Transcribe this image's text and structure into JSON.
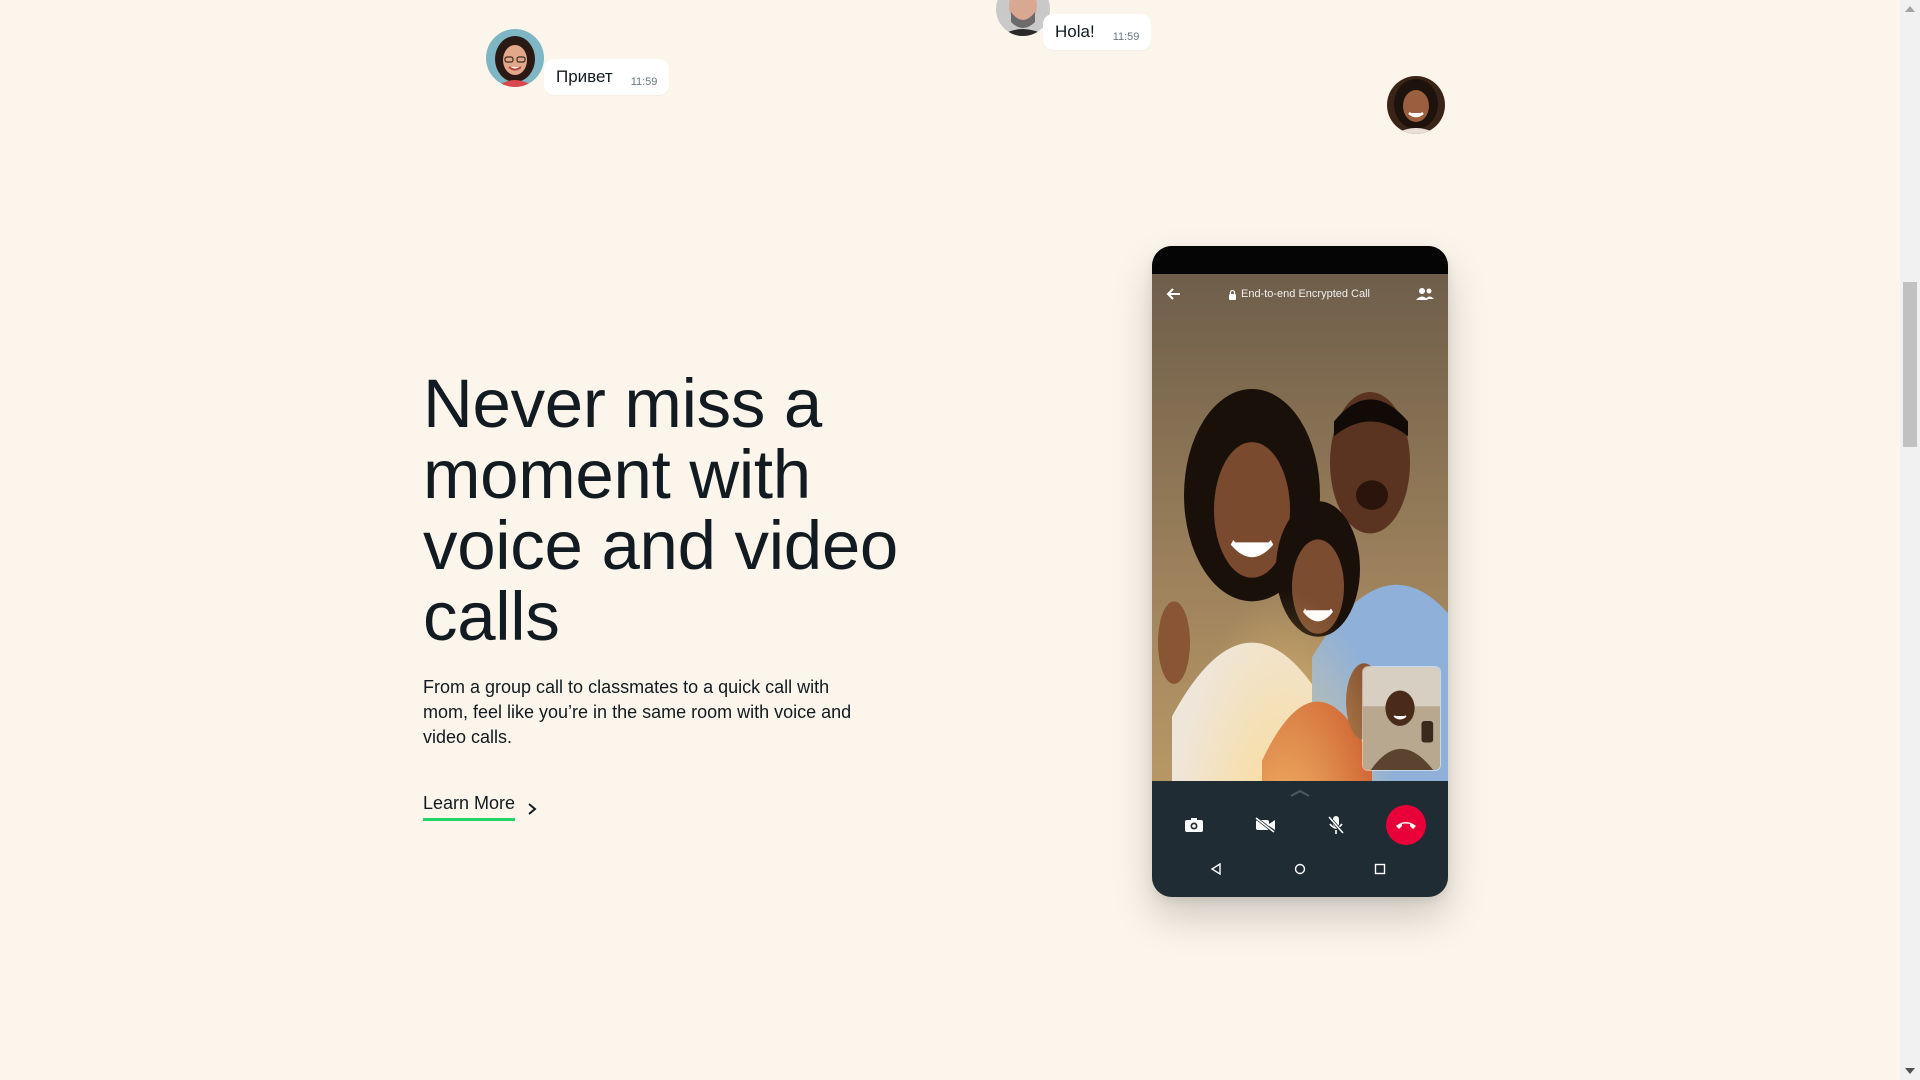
{
  "chats": [
    {
      "message": "Привет",
      "time": "11:59"
    },
    {
      "message": "Hola!",
      "time": "11:59"
    }
  ],
  "hero": {
    "headline": "Never miss a moment with voice and video calls",
    "description": "From a group call to classmates to a quick call with mom, feel like you’re in the same room with voice and video calls.",
    "cta_label": "Learn More"
  },
  "phone": {
    "header_label": "End-to-end Encrypted Call",
    "icons": [
      "back-arrow-icon",
      "lock-icon",
      "participants-icon",
      "camera-flip-icon",
      "video-off-icon",
      "mic-off-icon",
      "end-call-icon",
      "nav-back-icon",
      "nav-home-icon",
      "nav-recents-icon"
    ]
  },
  "colors": {
    "background": "#fcf5eb",
    "accent": "#25d366",
    "end_call": "#ea0038",
    "controls_bar": "#1f2c34"
  }
}
